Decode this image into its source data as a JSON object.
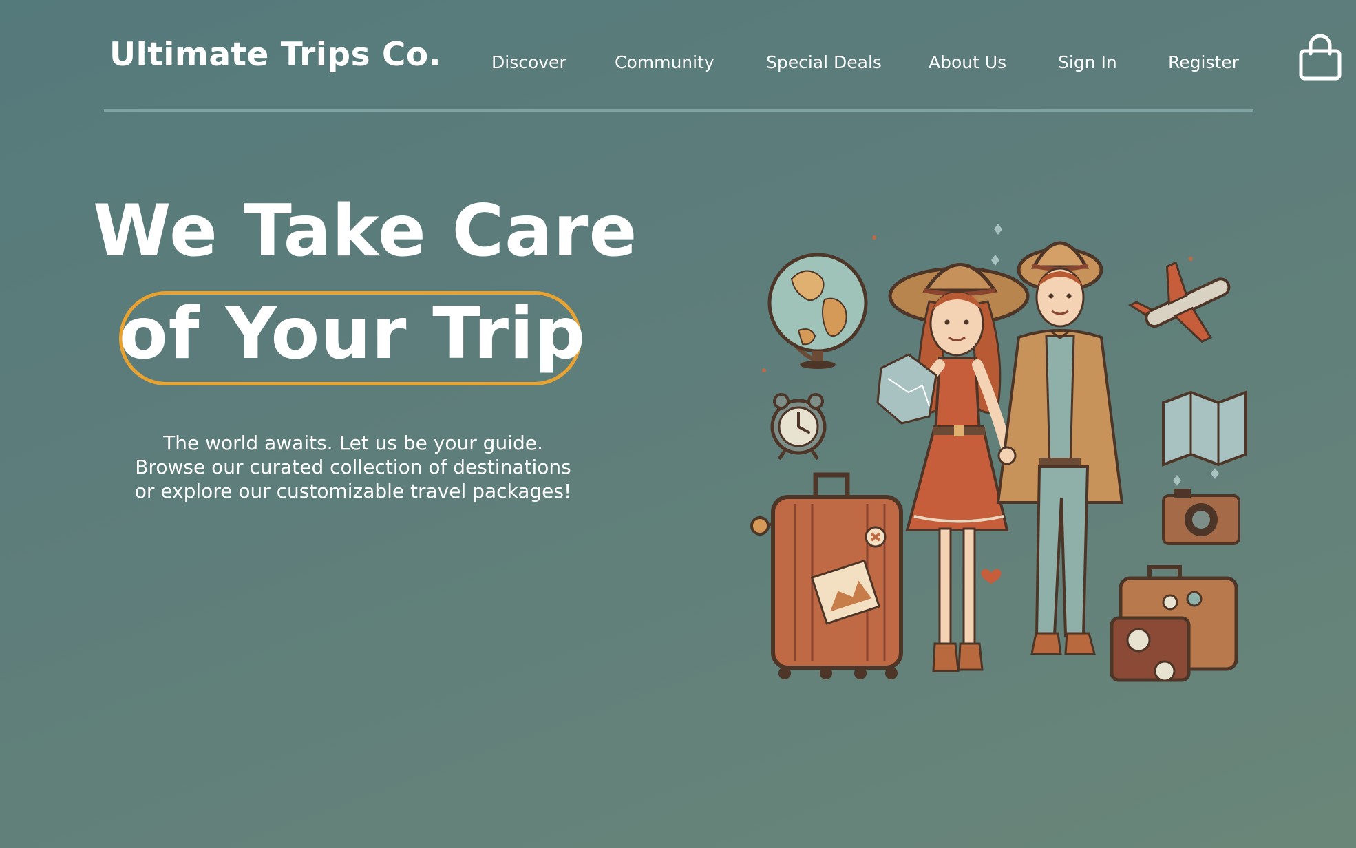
{
  "brand": {
    "name": "Ultimate Trips Co."
  },
  "nav": {
    "items": [
      {
        "label": "Discover"
      },
      {
        "label": "Community"
      },
      {
        "label": "Special Deals"
      },
      {
        "label": "About Us"
      },
      {
        "label": "Sign In"
      },
      {
        "label": "Register"
      }
    ],
    "cart_icon": "shopping-bag-icon"
  },
  "hero": {
    "headline_line1": "We Take Care",
    "headline_line2": "of Your Trip",
    "subtext": "The world awaits. Let us be your guide. Browse our curated collection of destinations or explore our customizable travel packages!"
  },
  "colors": {
    "background": "#5b7b7b",
    "accent": "#e8a232",
    "divider": "#7fa3a3",
    "text": "#ffffff"
  }
}
